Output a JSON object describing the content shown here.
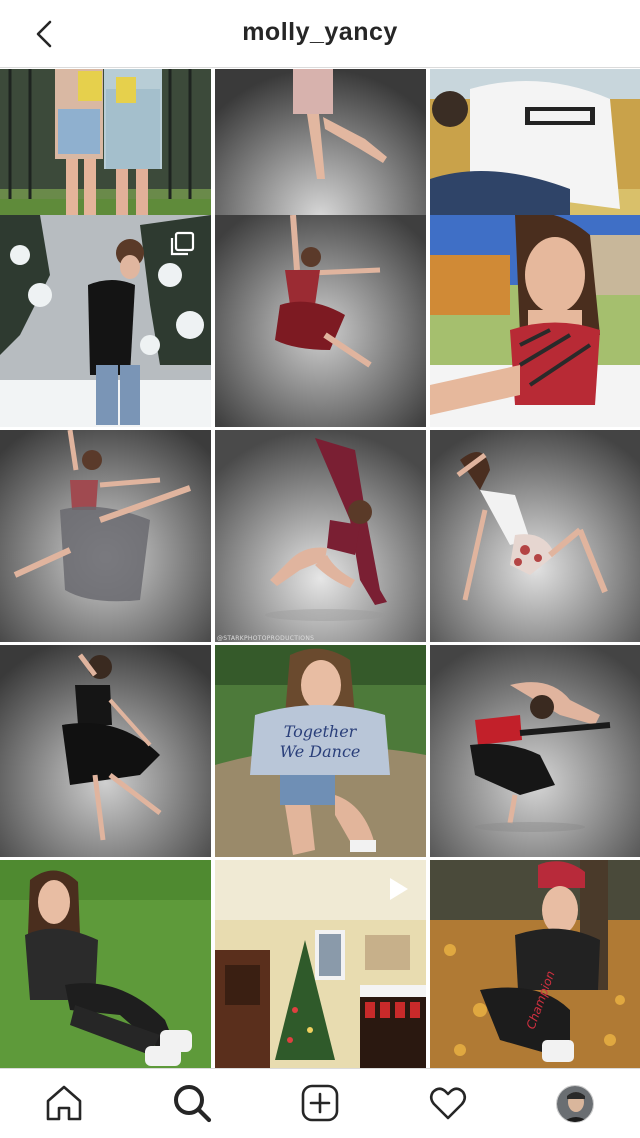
{
  "header": {
    "username": "molly_yancy",
    "back_icon": "chevron-left-icon"
  },
  "grid": {
    "overlay_badges": [
      {
        "post": 4,
        "type": "carousel-icon"
      },
      {
        "post": 14,
        "type": "video-play-icon"
      }
    ],
    "photo_credit": "@STARKPHOTOPRODUCTIONS",
    "printed_text_in_photos": [
      "Together We Dance",
      "Champion"
    ]
  },
  "tabbar": {
    "icons": [
      "home-icon",
      "search-icon",
      "new-post-icon",
      "heart-icon",
      "profile-avatar"
    ],
    "active": "search-icon"
  },
  "colors": {
    "background": "#ffffff",
    "text": "#262626",
    "divider": "#dbdbdb"
  }
}
